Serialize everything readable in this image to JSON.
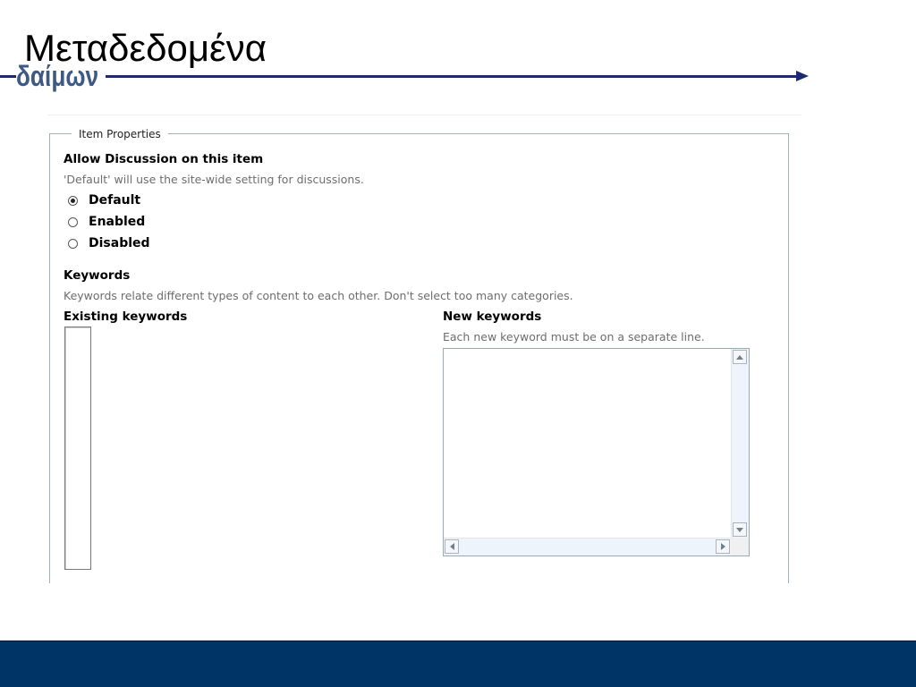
{
  "slide": {
    "title": "Μεταδεδομένα",
    "brand": "δαίμων"
  },
  "form": {
    "legend": "Item Properties",
    "discussion": {
      "label": "Allow Discussion on this item",
      "help": "'Default' will use the site-wide setting for discussions.",
      "options": [
        {
          "label": "Default",
          "selected": true
        },
        {
          "label": "Enabled",
          "selected": false
        },
        {
          "label": "Disabled",
          "selected": false
        }
      ]
    },
    "keywords": {
      "label": "Keywords",
      "help": "Keywords relate different types of content to each other. Don't select too many categories.",
      "existing_label": "Existing keywords",
      "new_label": "New keywords",
      "new_help": "Each new keyword must be on a separate line."
    }
  },
  "colors": {
    "brand_line": "#1f2a6b",
    "brand_text": "#3e5a84",
    "footer": "#003366",
    "fieldset_border": "#9ab0c4"
  }
}
